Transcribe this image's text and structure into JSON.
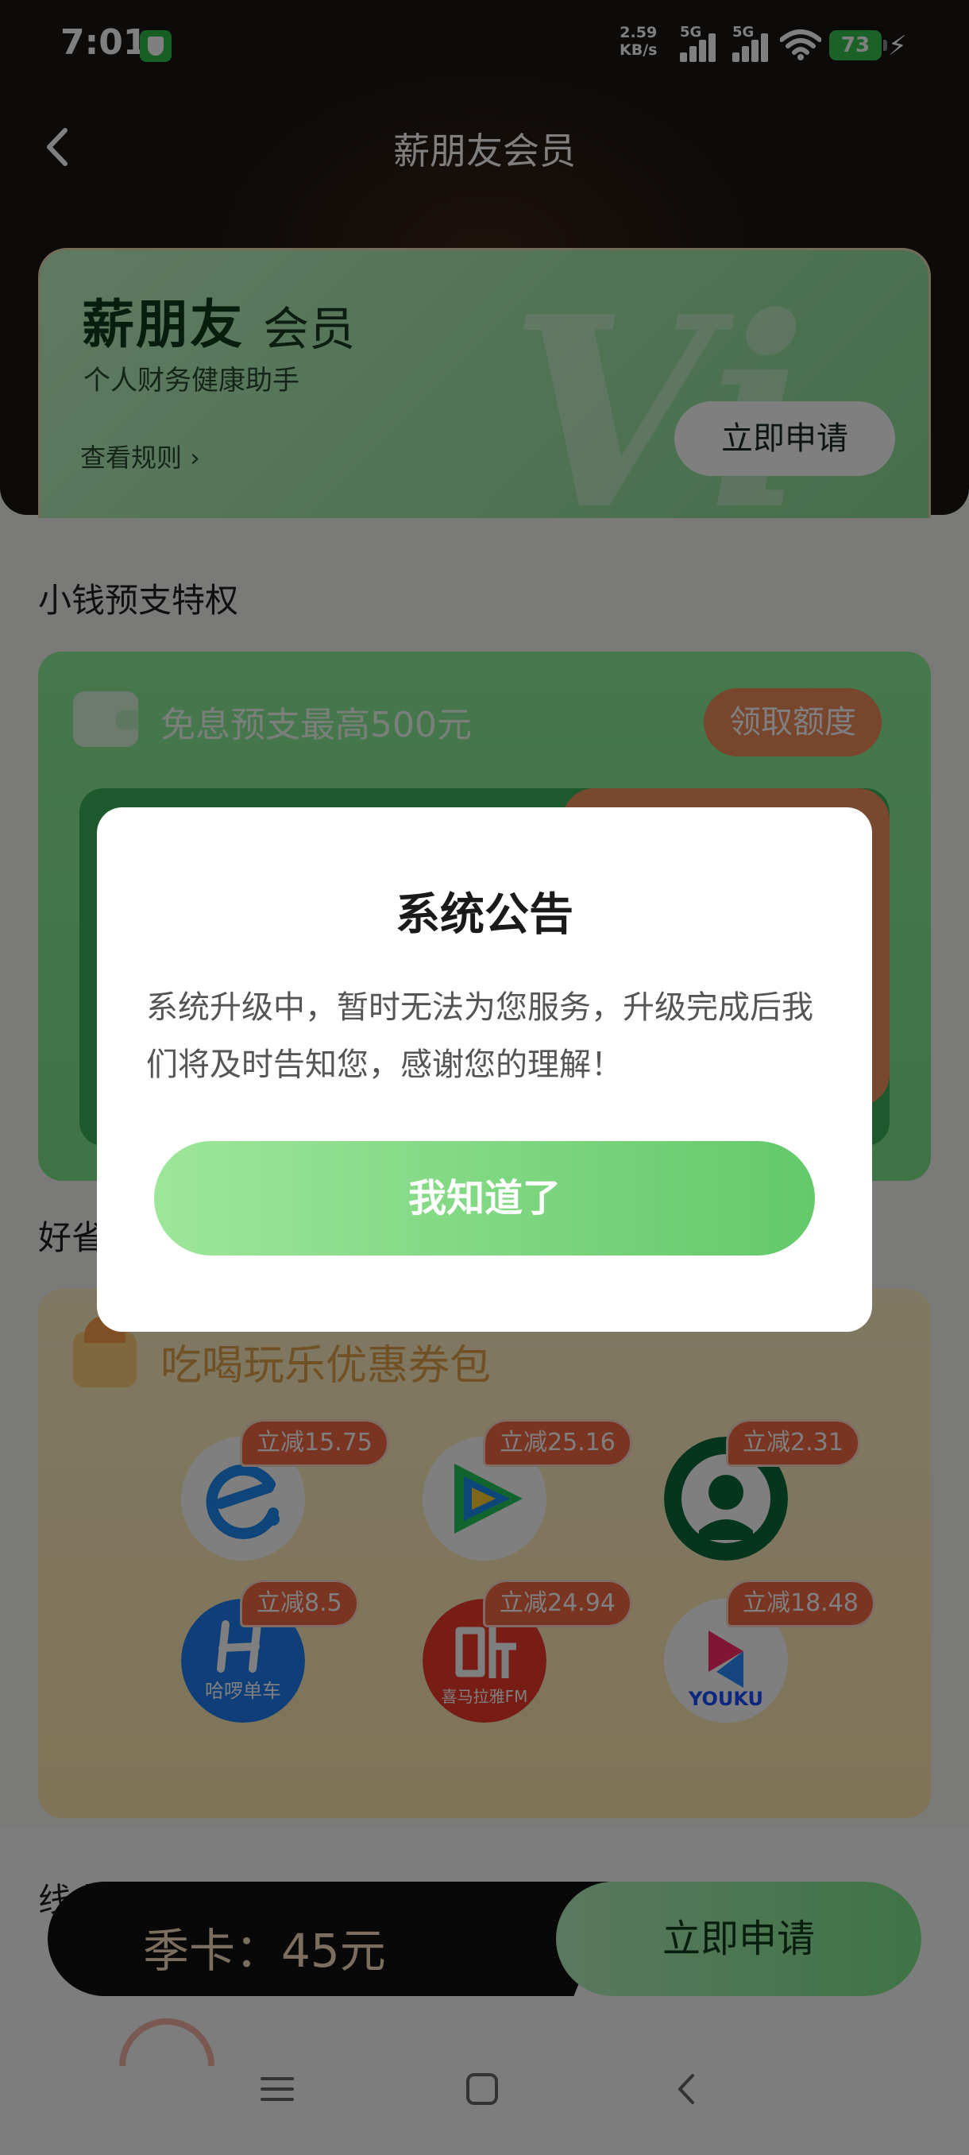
{
  "status_bar": {
    "time": "7:01",
    "net_speed_value": "2.59",
    "net_speed_unit": "KB/s",
    "signal_1_label": "5G",
    "signal_2_label": "5G",
    "battery_level": "73"
  },
  "header": {
    "title": "薪朋友会员"
  },
  "vip_card": {
    "brand": "薪朋友",
    "brand_suffix": "会员",
    "subtitle": "个人财务健康助手",
    "rules_link": "查看规则 ›",
    "apply_label": "立即申请",
    "watermark": "Vi"
  },
  "advance_section": {
    "title": "小钱预支特权",
    "label": "免息预支最高500元",
    "claim_label": "领取额度"
  },
  "save_section": {
    "title": "好省",
    "coupon_title": "吃喝玩乐优惠券包",
    "coupons": [
      {
        "icon": "eleme-icon",
        "discount": "立减15.75"
      },
      {
        "icon": "tencent-video-icon",
        "discount": "立减25.16"
      },
      {
        "icon": "starbucks-icon",
        "discount": "立减2.31"
      },
      {
        "icon": "hellobike-icon",
        "discount": "立减8.5",
        "brand_text": "哈啰单车"
      },
      {
        "icon": "ximalaya-icon",
        "discount": "立减24.94",
        "brand_text": "喜马拉雅FM"
      },
      {
        "icon": "youku-icon",
        "discount": "立减18.48",
        "brand_text": "YOUKU"
      }
    ]
  },
  "online_section": {
    "title": "线上特权"
  },
  "buy_bar": {
    "price": "季卡：45元",
    "apply_label": "立即申请"
  },
  "modal": {
    "title": "系统公告",
    "body": "系统升级中，暂时无法为您服务，升级完成后我们将及时告知您，感谢您的理解！",
    "confirm_label": "我知道了"
  },
  "colors": {
    "accent_green": "#63c96a",
    "discount_red": "#f26a45",
    "dark_header": "#1a1614"
  }
}
